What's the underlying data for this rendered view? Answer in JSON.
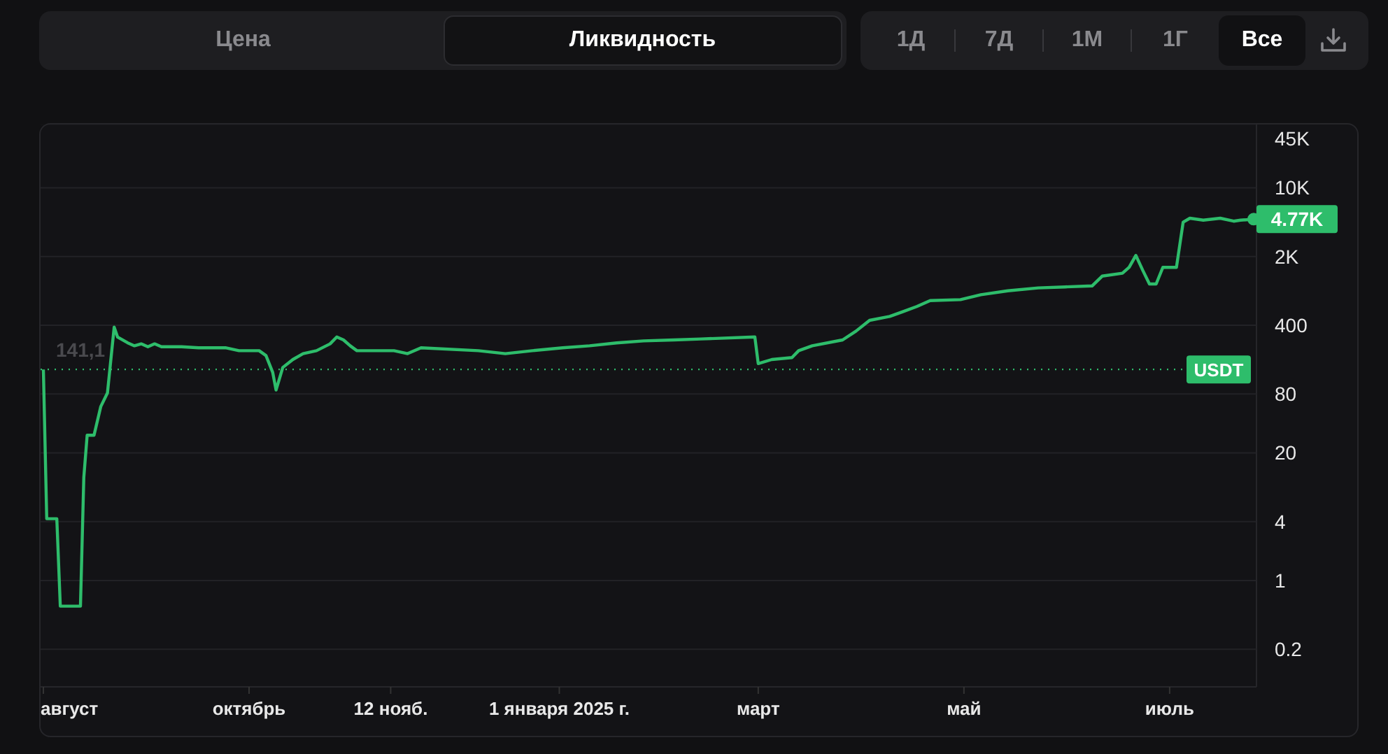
{
  "tabs": [
    {
      "label": "Цена",
      "selected": false
    },
    {
      "label": "Ликвидность",
      "selected": true
    }
  ],
  "periods": [
    {
      "label": "1Д",
      "selected": false
    },
    {
      "label": "7Д",
      "selected": false
    },
    {
      "label": "1М",
      "selected": false
    },
    {
      "label": "1Г",
      "selected": false
    },
    {
      "label": "Все",
      "selected": true
    }
  ],
  "chart": {
    "reference_label": "141,1",
    "currency_badge": "USDT",
    "current_value_badge": "4.77K",
    "y_axis_labels": [
      "45K",
      "10K",
      "2K",
      "400",
      "80",
      "20",
      "4",
      "1",
      "0.2"
    ],
    "x_axis_labels": [
      "август",
      "октябрь",
      "12 нояб.",
      "1 января 2025 г.",
      "март",
      "май",
      "июль"
    ]
  }
}
